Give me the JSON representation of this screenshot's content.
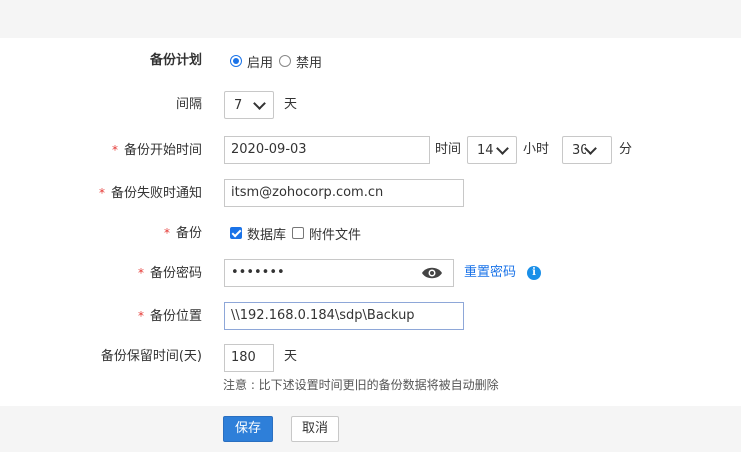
{
  "form": {
    "schedule": {
      "label": "备份计划",
      "options": [
        {
          "label": "启用",
          "selected": true
        },
        {
          "label": "禁用",
          "selected": false
        }
      ]
    },
    "interval": {
      "label": "间隔",
      "value": "7",
      "unit": "天"
    },
    "start_time": {
      "required": "*",
      "label": "备份开始时间",
      "date": "2020-09-03",
      "time_label": "时间",
      "hour": "14",
      "hour_unit": "小时",
      "minute": "30",
      "minute_unit": "分"
    },
    "failure_notify": {
      "required": "*",
      "label": "备份失败时通知",
      "value": "itsm@zohocorp.com.cn"
    },
    "backup": {
      "required": "*",
      "label": "备份",
      "options": [
        {
          "label": "数据库",
          "checked": true
        },
        {
          "label": "附件文件",
          "checked": false
        }
      ]
    },
    "password": {
      "required": "*",
      "label": "备份密码",
      "value": "•••••••",
      "reset_link": "重置密码",
      "info_glyph": "i"
    },
    "location": {
      "required": "*",
      "label": "备份位置",
      "value": "\\\\192.168.0.184\\sdp\\Backup"
    },
    "retention": {
      "label": "备份保留时间(天)",
      "value": "180",
      "unit": "天"
    },
    "note": "注意 : 比下述设置时间更旧的备份数据将被自动删除"
  },
  "actions": {
    "save": "保存",
    "cancel": "取消"
  },
  "colors": {
    "accent": "#1a73e8",
    "required": "#e53935",
    "primary_button": "#2e7fd9",
    "info": "#1a8fe8"
  },
  "icons": {
    "password_toggle": "eye-icon",
    "info": "info-icon",
    "dropdown": "chevron-down-icon"
  }
}
